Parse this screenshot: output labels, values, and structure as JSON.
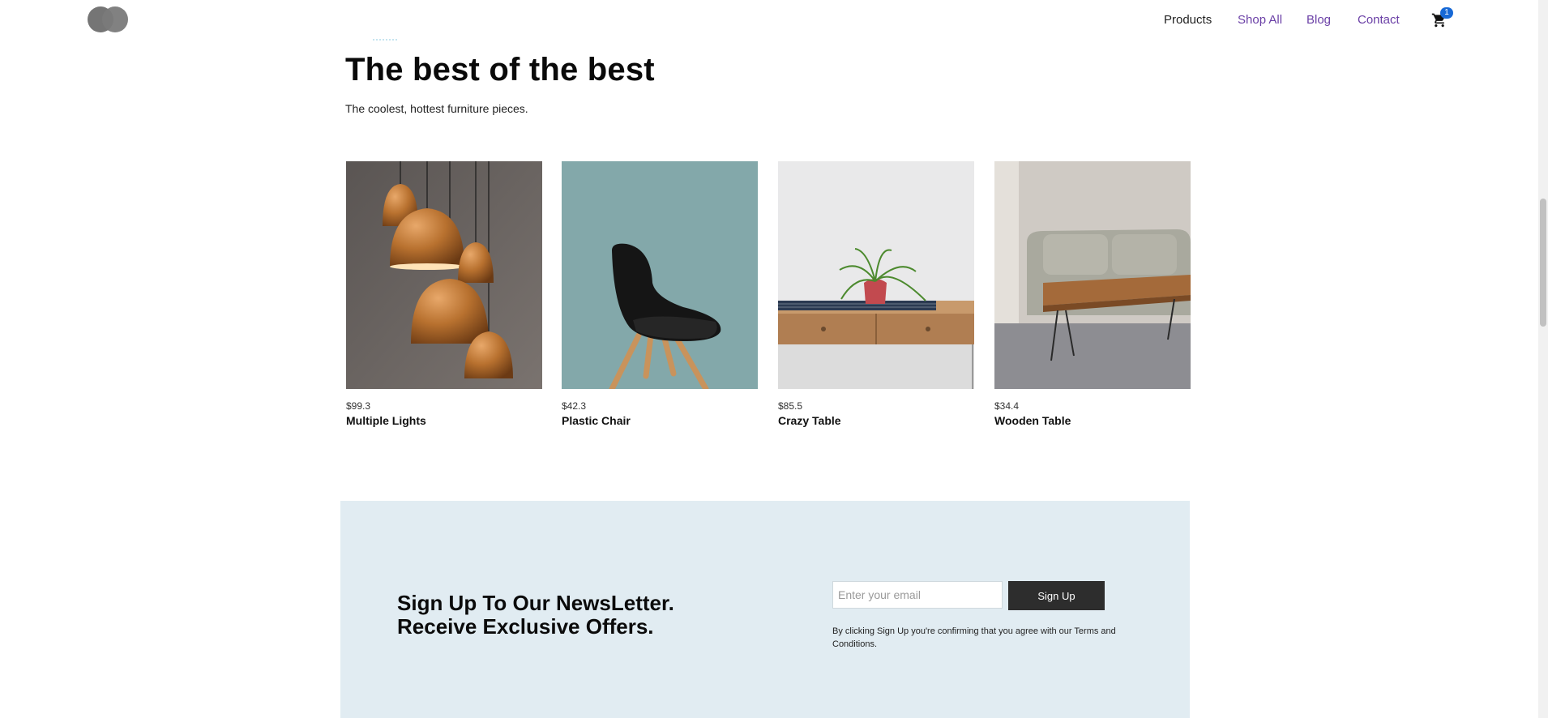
{
  "nav": {
    "items": [
      {
        "label": "Products",
        "style": "dark"
      },
      {
        "label": "Shop All",
        "style": "accent"
      },
      {
        "label": "Blog",
        "style": "accent"
      },
      {
        "label": "Contact",
        "style": "accent"
      }
    ],
    "cart_count": "1"
  },
  "hero": {
    "title": "The best of the best",
    "subtitle": "The coolest, hottest furniture pieces."
  },
  "products": [
    {
      "price": "$99.3",
      "name": "Multiple Lights"
    },
    {
      "price": "$42.3",
      "name": "Plastic Chair"
    },
    {
      "price": "$85.5",
      "name": "Crazy Table"
    },
    {
      "price": "$34.4",
      "name": "Wooden Table"
    }
  ],
  "newsletter": {
    "title_line1": "Sign Up To Our NewsLetter.",
    "title_line2": "Receive Exclusive Offers.",
    "email_placeholder": "Enter your email",
    "button_label": "Sign Up",
    "terms": "By clicking Sign Up you're confirming that you agree with our Terms and Conditions."
  },
  "colors": {
    "accent": "#6a3fa6",
    "badge": "#1769d6",
    "newsletter_bg": "#e1ecf2",
    "button_bg": "#2d2d2d"
  }
}
